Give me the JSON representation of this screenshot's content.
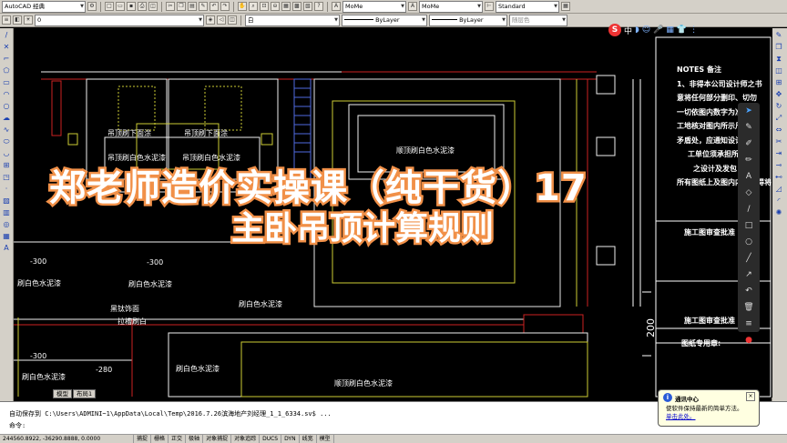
{
  "toolbar": {
    "workspace": "AutoCAD 经典",
    "layer": "0",
    "textstyle1": "MoMe",
    "textstyle2": "MoMe",
    "dimstyle": "Standard",
    "color": "白",
    "linetype": "ByLayer",
    "lineweight": "ByLayer",
    "plotstyle": "随层色"
  },
  "drawing": {
    "labels": {
      "ceiling1": "吊顶刷下面涂",
      "ceiling2": "吊顶刷下面涂",
      "ceiling_a": "吊顶刷白色水泥漆",
      "ceiling_b": "吊顶刷白色水泥漆",
      "ceiling_c": "顺顶刷白色水泥漆",
      "paint_mid": "刷白色水",
      "dim1": "-300",
      "dim2": "-300",
      "dim3": "-300",
      "dim4": "-280",
      "paint1": "刷白色水泥漆",
      "paint2": "刷白色水泥漆",
      "paint3": "刷白色水泥漆",
      "paint4": "刷白色水泥漆",
      "paint5": "刷白色水泥漆",
      "black1": "黑钛饰面",
      "black2": "拉槽刷白",
      "bottom": "顺顶刷白色水泥漆",
      "vertical_dim": "200"
    },
    "notes": [
      "NOTES  备注",
      "1、非得本公司设计师之书",
      "意将任何部分删印、切勿",
      "一切依图内数字为准。",
      "工地核对图内所示尺寸之",
      "矛盾处，应通知设计师。",
      "工单位须承担所有",
      "之设计及发包",
      "所有图纸上及图内内容不得将"
    ],
    "review1": "施工图审查批准",
    "review2": "施工图审查批准",
    "seal": "图纸专用章:"
  },
  "overlay": {
    "title": "郑老师造价实操课（纯干货）17",
    "subtitle": "主卧吊顶计算规则"
  },
  "ime": {
    "brand": "S",
    "mode": "中"
  },
  "tabs": [
    "模型",
    "布局1"
  ],
  "command": {
    "autosave": "自动保存到  C:\\Users\\ADMINI~1\\AppData\\Local\\Temp\\2016.7.26滨海地产刘经理_1_1_6334.sv$ ...",
    "prompt": "命令:"
  },
  "status": {
    "coords": "244560.8922, -36290.8888, 0.0000",
    "buttons": [
      "捕捉",
      "栅格",
      "正交",
      "极轴",
      "对象捕捉",
      "对象追踪",
      "DUCS",
      "DYN",
      "线宽",
      "模型"
    ]
  },
  "notification": {
    "title": "通讯中心",
    "body": "使软件保持最新的简单方法。",
    "link": "单击此处。"
  }
}
